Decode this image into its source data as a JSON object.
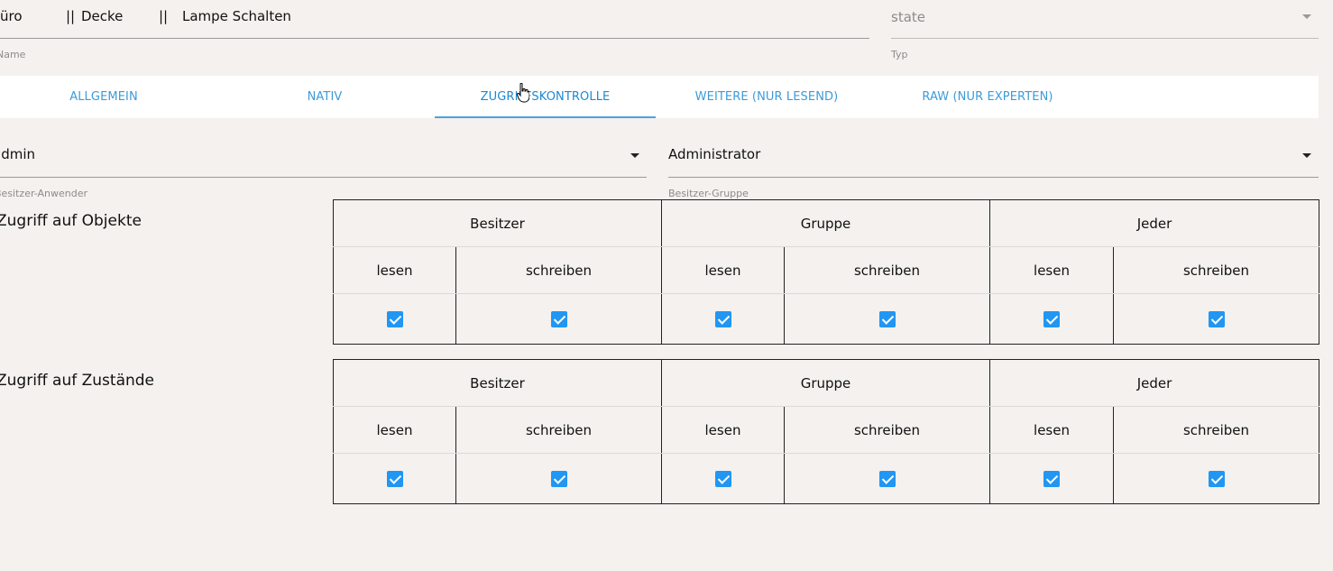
{
  "name_field": {
    "segments": [
      "üro",
      "||",
      "Decke",
      "||",
      "Lampe Schalten"
    ],
    "helper": "Name"
  },
  "type_field": {
    "value": "state",
    "helper": "Typ"
  },
  "tabs": [
    {
      "label": "ALLGEMEIN",
      "active": false
    },
    {
      "label": "NATIV",
      "active": false
    },
    {
      "label": "ZUGRIFFSKONTROLLE",
      "active": true
    },
    {
      "label": "WEITERE (NUR LESEND)",
      "active": false
    },
    {
      "label": "RAW (NUR EXPERTEN)",
      "active": false
    }
  ],
  "owner_user": {
    "value": "admin",
    "helper": "Besitzer-Anwender"
  },
  "owner_group": {
    "value": "Administrator",
    "helper": "Besitzer-Gruppe"
  },
  "sections": [
    {
      "title": "Zugriff auf Objekte",
      "groups": [
        "Besitzer",
        "Gruppe",
        "Jeder"
      ],
      "rights": [
        "lesen",
        "schreiben",
        "lesen",
        "schreiben",
        "lesen",
        "schreiben"
      ],
      "checked": [
        true,
        true,
        true,
        true,
        true,
        true
      ]
    },
    {
      "title": "Zugriff auf Zustände",
      "groups": [
        "Besitzer",
        "Gruppe",
        "Jeder"
      ],
      "rights": [
        "lesen",
        "schreiben",
        "lesen",
        "schreiben",
        "lesen",
        "schreiben"
      ],
      "checked": [
        true,
        true,
        true,
        true,
        true,
        true
      ]
    }
  ],
  "colors": {
    "accent": "#2196f3",
    "tab_text": "#3d9bd8",
    "background": "#f4f1ee"
  },
  "icons": {
    "dropdown": "arrow-drop-down-icon",
    "checkbox": "checkbox-checked-icon",
    "cursor": "hand-pointer-icon"
  }
}
